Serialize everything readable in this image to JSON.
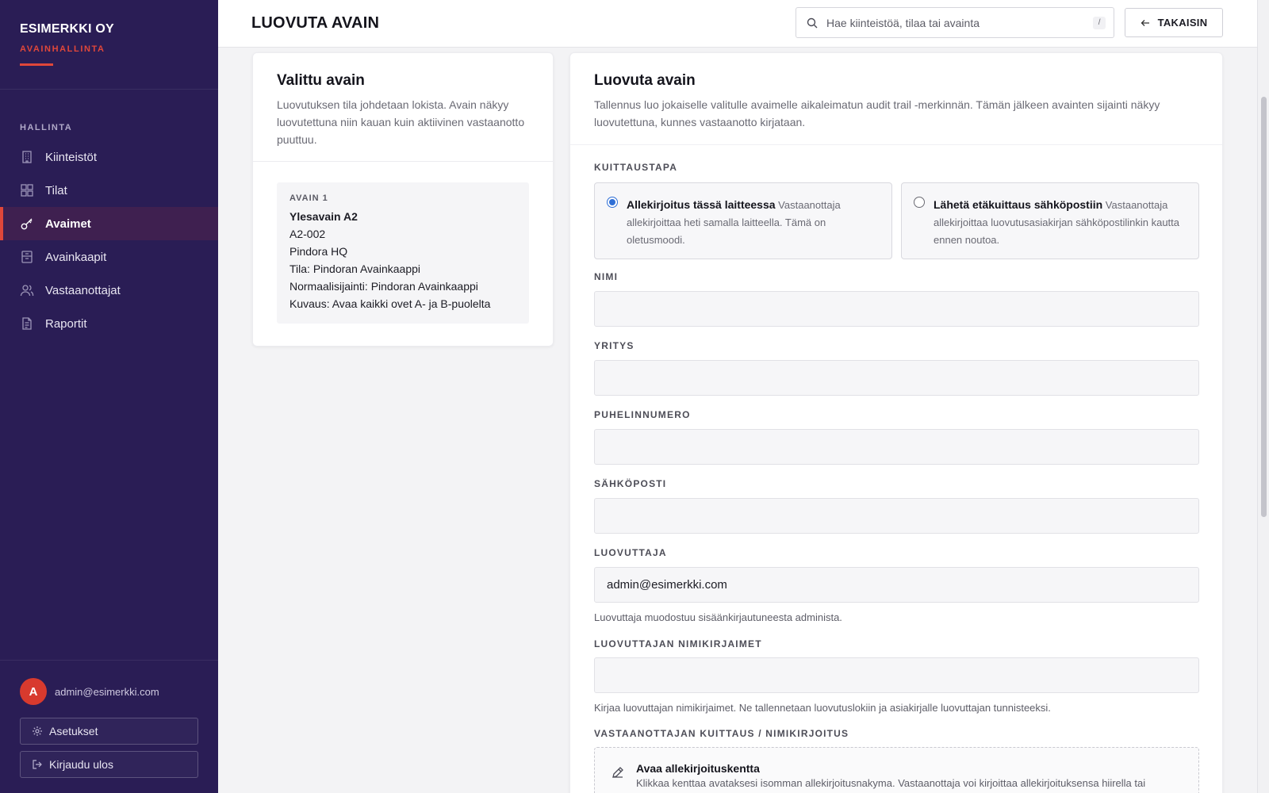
{
  "brand": {
    "name": "ESIMERKKI OY",
    "subtitle": "AVAINHALLINTA"
  },
  "sidebar": {
    "heading": "HALLINTA",
    "items": [
      {
        "label": "Kiinteistöt",
        "icon": "building-icon",
        "active": false
      },
      {
        "label": "Tilat",
        "icon": "grid-icon",
        "active": false
      },
      {
        "label": "Avaimet",
        "icon": "key-icon",
        "active": true
      },
      {
        "label": "Avainkaapit",
        "icon": "cabinet-icon",
        "active": false
      },
      {
        "label": "Vastaanottajat",
        "icon": "users-icon",
        "active": false
      },
      {
        "label": "Raportit",
        "icon": "report-icon",
        "active": false
      }
    ],
    "user": {
      "initial": "A",
      "email": "admin@esimerkki.com"
    },
    "settings_label": "Asetukset",
    "logout_label": "Kirjaudu ulos"
  },
  "header": {
    "title": "LUOVUTA AVAIN",
    "search_placeholder": "Hae kiinteistöä, tilaa tai avainta",
    "search_shortcut": "/",
    "back_label": "TAKAISIN"
  },
  "selected_key": {
    "title": "Valittu avain",
    "description": "Luovutuksen tila johdetaan lokista. Avain näkyy luovutettuna niin kauan kuin aktiivinen vastaanotto puuttuu.",
    "key_label": "AVAIN 1",
    "key_name": "Ylesavain A2",
    "key_code": "A2-002",
    "property": "Pindora HQ",
    "space": "Tila: Pindoran Avainkaappi",
    "normal_location": "Normaalisijainti: Pindoran Avainkaappi",
    "key_description": "Kuvaus: Avaa kaikki ovet A- ja B-puolelta"
  },
  "handover": {
    "title": "Luovuta avain",
    "description": "Tallennus luo jokaiselle valitulle avaimelle aikaleimatun audit trail -merkinnän. Tämän jälkeen avainten sijainti näkyy luovutettuna, kunnes vastaanotto kirjataan.",
    "receipt_method_label": "KUITTAUSTAPA",
    "options": [
      {
        "title": "Allekirjoitus tässä laitteessa",
        "text": "Vastaanottaja allekirjoittaa heti samalla laitteella. Tämä on oletusmoodi.",
        "checked": true
      },
      {
        "title": "Lähetä etäkuittaus sähköpostiin",
        "text": "Vastaanottaja allekirjoittaa luovutusasiakirjan sähköpostilinkin kautta ennen noutoa.",
        "checked": false
      }
    ],
    "fields": {
      "name_label": "NIMI",
      "name_value": "",
      "company_label": "YRITYS",
      "company_value": "",
      "phone_label": "PUHELINNUMERO",
      "phone_value": "",
      "email_label": "SÄHKÖPOSTI",
      "email_value": "",
      "handover_by_label": "LUOVUTTAJA",
      "handover_by_value": "admin@esimerkki.com",
      "handover_by_help": "Luovuttaja muodostuu sisäänkirjautuneesta administa.",
      "initials_label": "LUOVUTTAJAN NIMIKIRJAIMET",
      "initials_value": "",
      "initials_help": "Kirjaa luovuttajan nimikirjaimet. Ne tallennetaan luovutuslokiin ja asiakirjalle luovuttajan tunnisteeksi.",
      "signature_label": "VASTAANOTTAJAN KUITTAUS / NIMIKIRJOITUS"
    },
    "signature": {
      "title": "Avaa allekirjoituskentta",
      "text": "Klikkaa kenttaa avataksesi isomman allekirjoitusnakyma. Vastaanottaja voi kirjoittaa allekirjoituksensa hiirella tai"
    }
  },
  "colors": {
    "sidebar": "#2a1d55",
    "accent": "#e0473a",
    "radio": "#2f6fd6"
  }
}
